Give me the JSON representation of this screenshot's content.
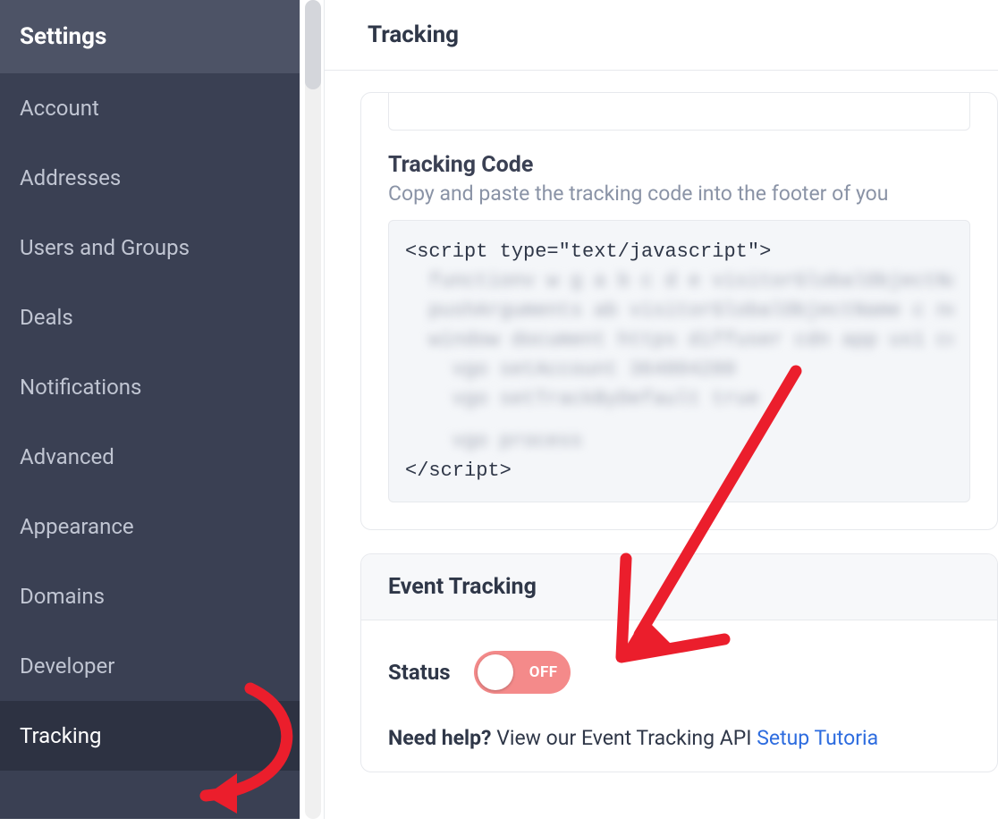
{
  "sidebar": {
    "title": "Settings",
    "items": [
      {
        "label": "Account",
        "active": false
      },
      {
        "label": "Addresses",
        "active": false
      },
      {
        "label": "Users and Groups",
        "active": false
      },
      {
        "label": "Deals",
        "active": false
      },
      {
        "label": "Notifications",
        "active": false
      },
      {
        "label": "Advanced",
        "active": false
      },
      {
        "label": "Appearance",
        "active": false
      },
      {
        "label": "Domains",
        "active": false
      },
      {
        "label": "Developer",
        "active": false
      },
      {
        "label": "Tracking",
        "active": true
      }
    ]
  },
  "main": {
    "title": "Tracking",
    "tracking_code": {
      "heading": "Tracking Code",
      "subtitle": "Copy and paste the tracking code into the footer of you",
      "script_open": "<script type=\"text/javascript\">",
      "script_close": "</script>"
    },
    "event_tracking": {
      "heading": "Event Tracking",
      "status_label": "Status",
      "toggle_state": "OFF",
      "help_strong": "Need help?",
      "help_text": " View our Event Tracking API ",
      "help_link": "Setup Tutoria"
    }
  }
}
